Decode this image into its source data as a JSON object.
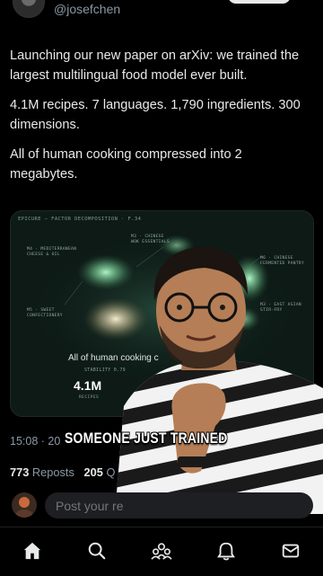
{
  "header": {
    "handle": "@josefchen"
  },
  "tweet": {
    "paragraphs": [
      "Launching our new paper on arXiv: we trained the largest multilingual food model ever built.",
      "4.1M recipes. 7 languages. 1,790 ingredients. 300 dimensions.",
      "All of human cooking compressed into 2 megabytes."
    ],
    "timestamp": "15:08 · 20",
    "reposts_count": "773",
    "reposts_label": "Reposts",
    "quotes_count": "205",
    "quotes_label": "Q"
  },
  "card": {
    "title": "EPICURE — FACTOR DECOMPOSITION · F.34",
    "labels": {
      "chinese_wok": [
        "M3 · CHINESE",
        "WOK ESSENTIALS"
      ],
      "mediterranean": [
        "M4 · MEDITERRANEAN",
        "CHEESE & OIL"
      ],
      "fermented": [
        "M6 · CHINESE",
        "FERMENTED PANTRY"
      ],
      "sweet": [
        "M5 · SWEET",
        "CONFECTIONERY"
      ],
      "eastasian": [
        "M3 · EAST ASIAN",
        "STIR-FRY"
      ]
    },
    "caption": "All of human cooking c",
    "stability": "STABILITY 0.79",
    "big_number": "4.1M",
    "big_number_label": "RECIPES"
  },
  "video": {
    "subtitle": "SOMEONE JUST TRAINED"
  },
  "reply": {
    "placeholder": "Post your re"
  },
  "nav": {
    "icons": [
      "home-icon",
      "search-icon",
      "communities-icon",
      "notifications-icon",
      "messages-icon"
    ]
  },
  "colors": {
    "background": "#000000",
    "text": "#e7e9ea",
    "muted": "#8b98a5",
    "cluster": "#8fe6b0"
  }
}
